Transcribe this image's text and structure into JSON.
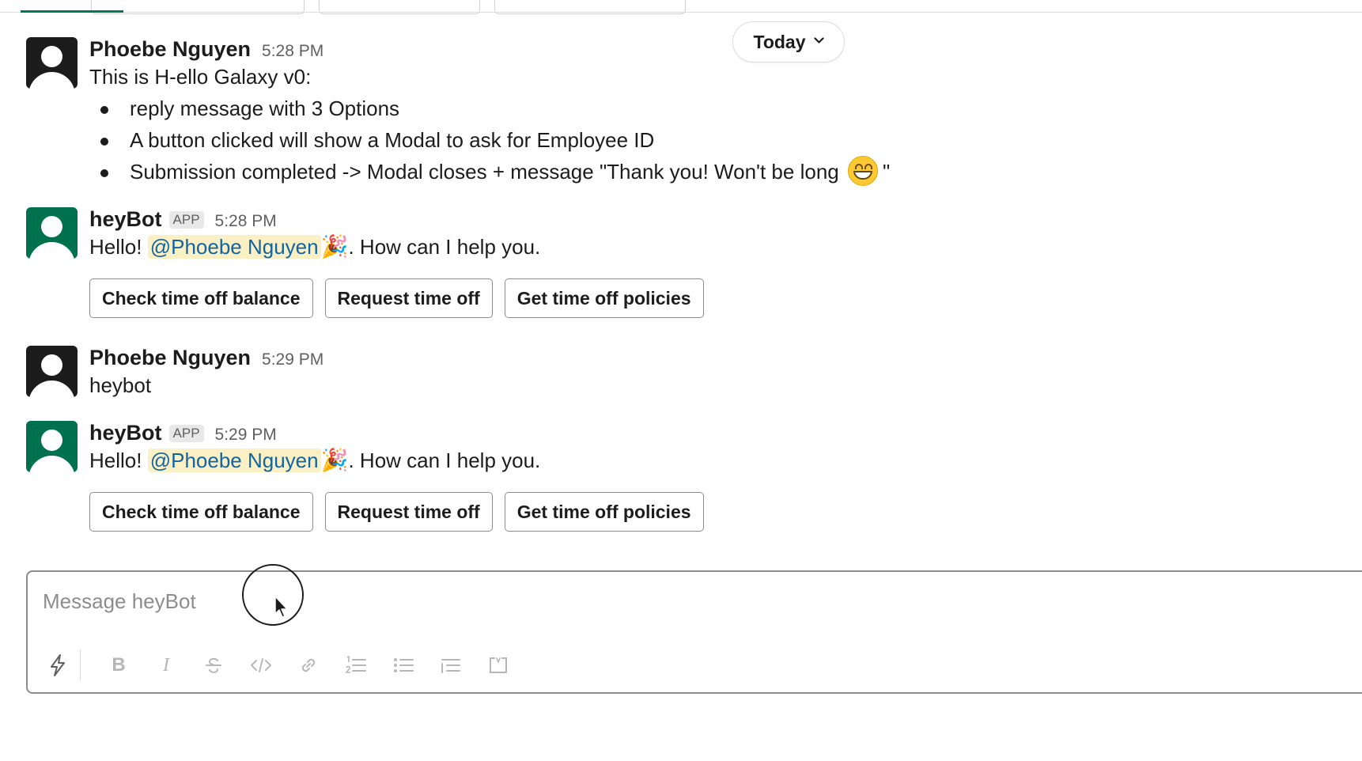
{
  "date_divider": {
    "label": "Today"
  },
  "messages": [
    {
      "author": "Phoebe Nguyen",
      "time": "5:28 PM",
      "intro": "This is H-ello Galaxy v0:",
      "bullets": [
        "reply message with 3 Options",
        "A button clicked will show a Modal to ask for Employee ID",
        "Submission completed -> Modal closes + message \"Thank you! Won't be long",
        "\""
      ]
    },
    {
      "author": "heyBot",
      "badge": "APP",
      "time": "5:28 PM",
      "hello": "Hello!",
      "mention": "@Phoebe Nguyen",
      "emoji": "🎉",
      "tail": ". How can I help you.",
      "buttons": [
        "Check time off balance",
        "Request time off",
        "Get time off policies"
      ]
    },
    {
      "author": "Phoebe Nguyen",
      "time": "5:29 PM",
      "text": "heybot"
    },
    {
      "author": "heyBot",
      "badge": "APP",
      "time": "5:29 PM",
      "hello": "Hello!",
      "mention": "@Phoebe Nguyen",
      "emoji": "🎉",
      "tail": ". How can I help you.",
      "buttons": [
        "Check time off balance",
        "Request time off",
        "Get time off policies"
      ]
    }
  ],
  "composer": {
    "placeholder": "Message heyBot",
    "toolbar_icons": [
      "shortcuts-icon",
      "bold-icon",
      "italic-icon",
      "strikethrough-icon",
      "code-icon",
      "link-icon",
      "ordered-list-icon",
      "bulleted-list-icon",
      "blockquote-icon",
      "code-block-icon"
    ],
    "toolbar_glyphs": {
      "bold": "B",
      "italic": "I"
    }
  },
  "colors": {
    "bot_avatar": "#00714d",
    "mention_bg": "#fbefc4",
    "mention_text": "#1264a3",
    "active_tab": "#007a5a"
  }
}
